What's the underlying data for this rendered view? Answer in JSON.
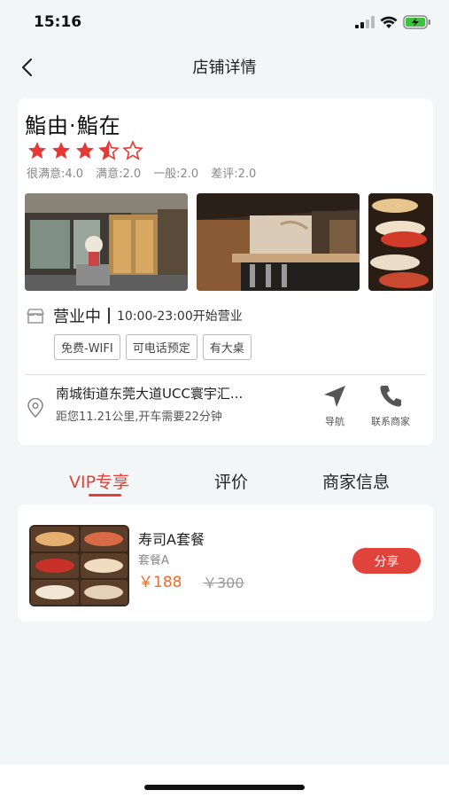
{
  "status_bar": {
    "time": "15:16",
    "icons": [
      "signal-icon",
      "wifi-icon",
      "battery-charging-icon"
    ]
  },
  "nav": {
    "title": "店铺详情",
    "back_icon": "chevron-left-icon"
  },
  "shop": {
    "name": "鮨由·鮨在",
    "rating_stars": 3.5,
    "rating_max": 5,
    "rating_breakdown": [
      "很满意:4.0",
      "满意:2.0",
      "一般:2.0",
      "差评:2.0"
    ],
    "photo_count_visible": 3,
    "hours_status": "营业中",
    "hours_text": "10:00-23:00开始营业",
    "tags": [
      "免费-WIFI",
      "可电话预定",
      "有大桌"
    ],
    "address": "南城街道东莞大道UCC寰宇汇...",
    "distance": "距您11.21公里,开车需要22分钟",
    "actions": [
      {
        "label": "导航",
        "icon": "navigation-arrow-icon"
      },
      {
        "label": "联系商家",
        "icon": "phone-icon"
      }
    ]
  },
  "tabs": [
    {
      "label": "VIP专享",
      "active": true
    },
    {
      "label": "评价",
      "active": false
    },
    {
      "label": "商家信息",
      "active": false
    }
  ],
  "deal": {
    "title": "寿司A套餐",
    "subtitle": "套餐A",
    "price": "￥188",
    "original_price": "￥300",
    "share_label": "分享"
  },
  "colors": {
    "accent": "#e0403a",
    "price": "#ee6a2e",
    "star": "#e53935",
    "background": "#f3f6f6"
  }
}
